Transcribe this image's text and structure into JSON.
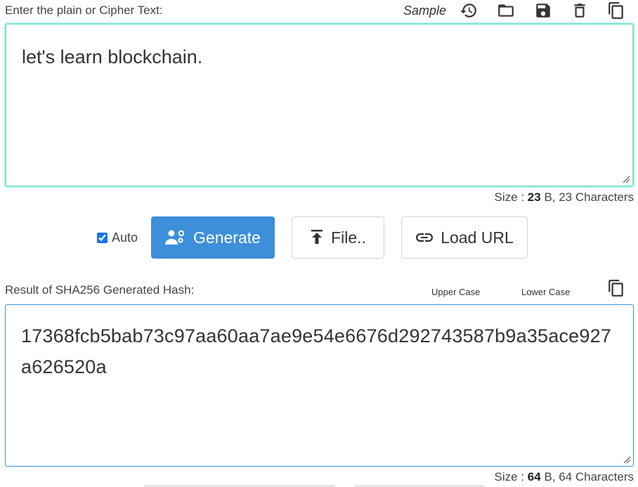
{
  "input_section": {
    "label": "Enter the plain or Cipher Text:",
    "sample_label": "Sample",
    "toolbar_icons": [
      "history-icon",
      "folder-open-icon",
      "save-icon",
      "delete-icon",
      "copy-icon"
    ],
    "text": "let's learn blockchain.",
    "size_prefix": "Size : ",
    "size_bytes": "23",
    "size_suffix": " B, 23 Characters"
  },
  "actions": {
    "auto_label": "Auto",
    "auto_checked": true,
    "generate_label": "Generate",
    "file_label": "File..",
    "load_url_label": "Load URL"
  },
  "output_section": {
    "label": "Result of SHA256 Generated Hash:",
    "upper_case_label": "Upper Case",
    "lower_case_label": "Lower Case",
    "hash": "17368fcb5bab73c97aa60aa7ae9e54e6676d292743587b9a35ace927a626520a",
    "size_prefix": "Size : ",
    "size_bytes": "64",
    "size_suffix": " B, 64 Characters"
  },
  "colors": {
    "primary": "#3c8fd8",
    "input_focus_border": "#7fe2cf",
    "output_border": "#3b8fd6"
  }
}
